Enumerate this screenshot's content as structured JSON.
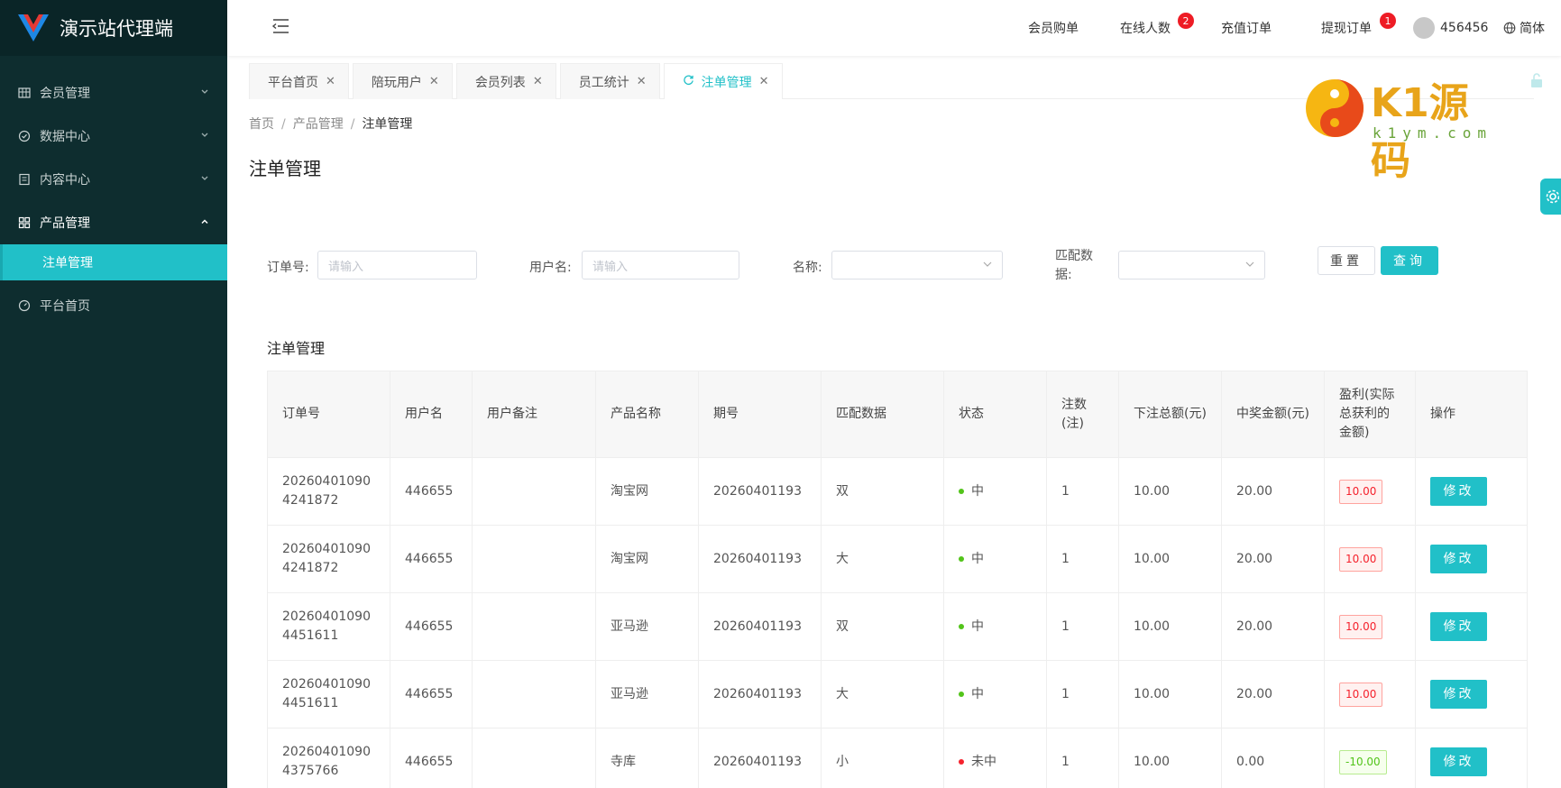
{
  "app": {
    "title": "演示站代理端"
  },
  "sidebar": {
    "items": [
      {
        "label": "会员管理",
        "icon": "grid-table-icon",
        "chevron": "chevron-down"
      },
      {
        "label": "数据中心",
        "icon": "check-circle-icon",
        "chevron": "chevron-down"
      },
      {
        "label": "内容中心",
        "icon": "document-icon",
        "chevron": "chevron-down"
      },
      {
        "label": "产品管理",
        "icon": "apps-icon",
        "chevron": "chevron-up"
      },
      {
        "label": "平台首页",
        "icon": "dashboard-icon"
      }
    ],
    "submenu": {
      "label": "注单管理"
    }
  },
  "header": {
    "links": {
      "member_purchase": "会员购单",
      "online_users": "在线人数",
      "recharge_orders": "充值订单",
      "withdraw_orders": "提现订单"
    },
    "badges": {
      "online_users": "2",
      "withdraw_orders": "1"
    },
    "username": "456456",
    "language": "简体"
  },
  "tabs": [
    {
      "label": "平台首页",
      "active": false
    },
    {
      "label": "陪玩用户",
      "active": false
    },
    {
      "label": "会员列表",
      "active": false
    },
    {
      "label": "员工统计",
      "active": false
    },
    {
      "label": "注单管理",
      "active": true
    }
  ],
  "breadcrumb": {
    "home": "首页",
    "parent": "产品管理",
    "current": "注单管理",
    "separator": "/"
  },
  "page_title": "注单管理",
  "watermark": {
    "brand": "K1源码",
    "domain": "k1ym.com"
  },
  "filters": {
    "order_no": {
      "label": "订单号:",
      "placeholder": "请输入"
    },
    "username": {
      "label": "用户名:",
      "placeholder": "请输入"
    },
    "name": {
      "label": "名称:",
      "value": ""
    },
    "match_data": {
      "label_line1": "匹配数",
      "label_line2": "据:",
      "value": ""
    },
    "reset_label": "重置",
    "query_label": "查询"
  },
  "table": {
    "title": "注单管理",
    "columns": [
      "订单号",
      "用户名",
      "用户备注",
      "产品名称",
      "期号",
      "匹配数据",
      "状态",
      "注数(注)",
      "下注总额(元)",
      "中奖金额(元)",
      "盈利(实际总获利的金额)",
      "操作"
    ],
    "rows": [
      {
        "order_no": "202604010904241872",
        "username": "446655",
        "remark": "",
        "product": "淘宝网",
        "period": "20260401193",
        "match": "双",
        "status": "中",
        "status_color": "#52c41a",
        "count": "1",
        "bet_total": "10.00",
        "win_amount": "20.00",
        "profit": "10.00",
        "profit_color": "#f5222d",
        "action": "修改"
      },
      {
        "order_no": "202604010904241872",
        "username": "446655",
        "remark": "",
        "product": "淘宝网",
        "period": "20260401193",
        "match": "大",
        "status": "中",
        "status_color": "#52c41a",
        "count": "1",
        "bet_total": "10.00",
        "win_amount": "20.00",
        "profit": "10.00",
        "profit_color": "#f5222d",
        "action": "修改"
      },
      {
        "order_no": "202604010904451611",
        "username": "446655",
        "remark": "",
        "product": "亚马逊",
        "period": "20260401193",
        "match": "双",
        "status": "中",
        "status_color": "#52c41a",
        "count": "1",
        "bet_total": "10.00",
        "win_amount": "20.00",
        "profit": "10.00",
        "profit_color": "#f5222d",
        "action": "修改"
      },
      {
        "order_no": "202604010904451611",
        "username": "446655",
        "remark": "",
        "product": "亚马逊",
        "period": "20260401193",
        "match": "大",
        "status": "中",
        "status_color": "#52c41a",
        "count": "1",
        "bet_total": "10.00",
        "win_amount": "20.00",
        "profit": "10.00",
        "profit_color": "#f5222d",
        "action": "修改"
      },
      {
        "order_no": "202604010904375766",
        "username": "446655",
        "remark": "",
        "product": "寺库",
        "period": "20260401193",
        "match": "小",
        "status": "未中",
        "status_color": "#f5222d",
        "count": "1",
        "bet_total": "10.00",
        "win_amount": "0.00",
        "profit": "-10.00",
        "profit_color": "#52c41a",
        "action": "修改"
      }
    ]
  },
  "colors": {
    "accent": "#21c0c8",
    "sidebar_bg": "#0e2d2f",
    "badge": "#ee1c25"
  }
}
